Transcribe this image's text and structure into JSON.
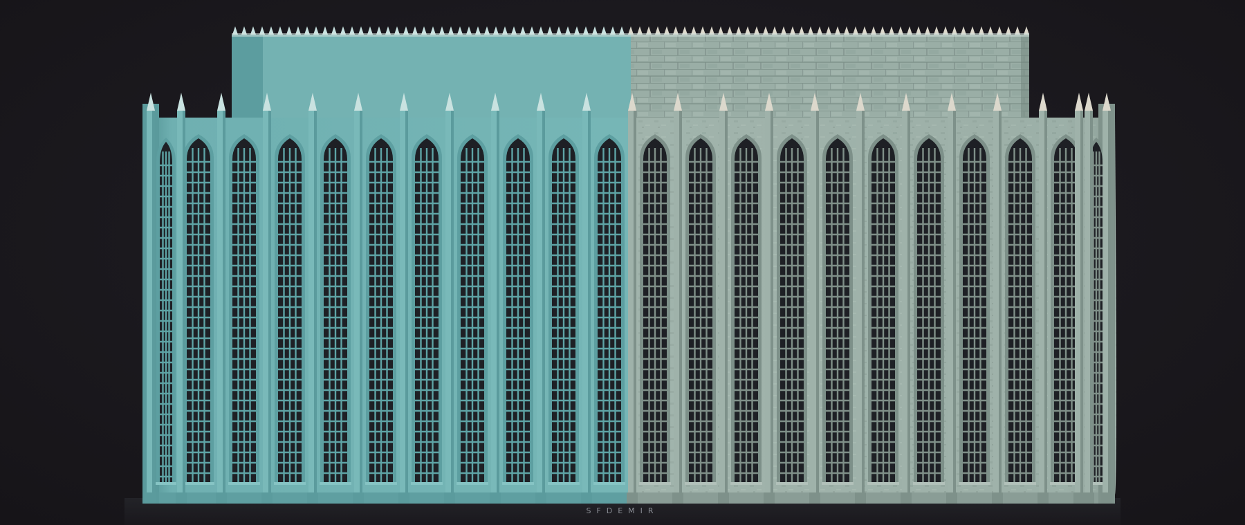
{
  "scene": {
    "subject": "gothic-building-render",
    "left_half_style": "untextured",
    "right_half_style": "stone-textured",
    "window_count_per_half": 10,
    "colors": {
      "background": "#1b191e",
      "untextured_base": "#6fb0b1",
      "untextured_light": "#84c3c3",
      "untextured_dark": "#4f8f91",
      "stone_base": "#9aaea6",
      "stone_light": "#b7c6be",
      "stone_dark": "#6f837c",
      "window_glass": "#1e2025",
      "window_grid_untextured": "#5ea3a5",
      "window_grid_stone": "#7f8f88",
      "spike_untextured": "#c9e2e0",
      "spike_stone": "#dcd8cc"
    }
  },
  "watermark": {
    "text": "SFDEMIR"
  }
}
